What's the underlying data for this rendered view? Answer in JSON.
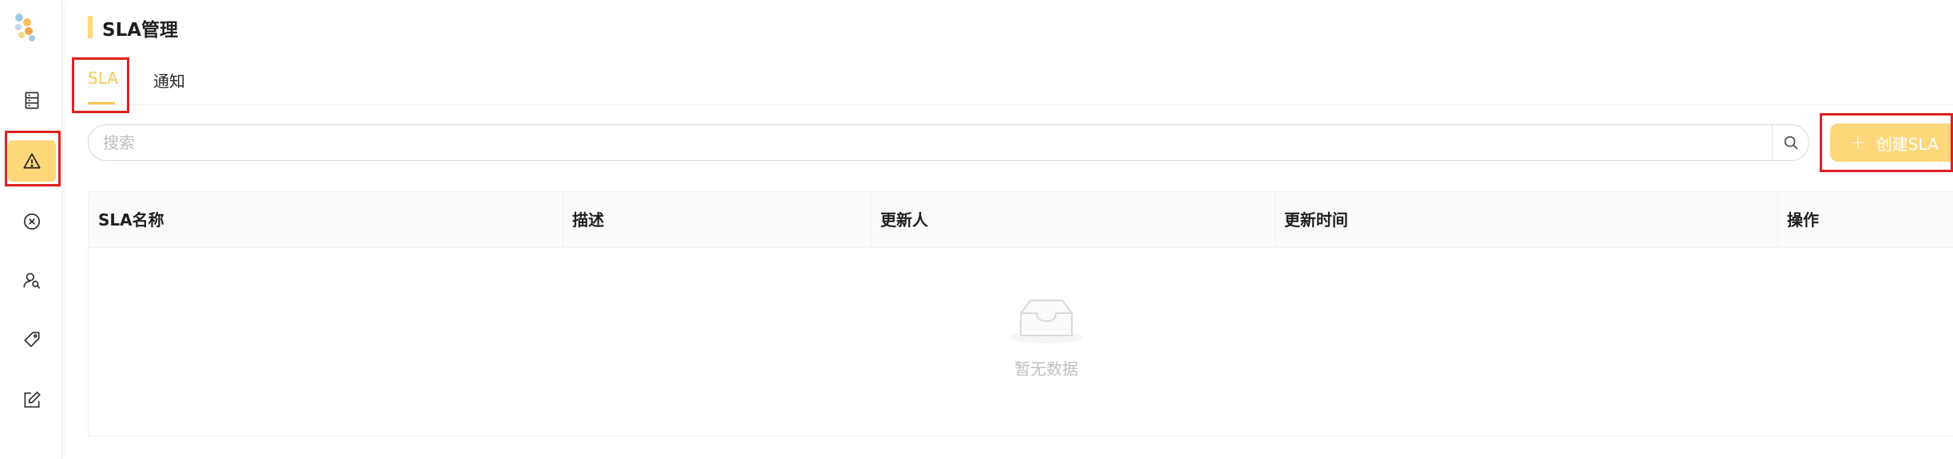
{
  "page": {
    "title": "SLA管理"
  },
  "sidebar": {
    "logo": "logo-icon",
    "items": [
      {
        "icon": "server-list-icon",
        "active": false
      },
      {
        "icon": "warning-triangle-icon",
        "active": true
      },
      {
        "icon": "close-circle-icon",
        "active": false
      },
      {
        "icon": "user-search-icon",
        "active": false
      },
      {
        "icon": "tag-icon",
        "active": false
      },
      {
        "icon": "edit-icon",
        "active": false
      }
    ]
  },
  "tabs": [
    {
      "label": "SLA",
      "active": true
    },
    {
      "label": "通知",
      "active": false
    }
  ],
  "search": {
    "placeholder": "搜索",
    "value": ""
  },
  "toolbar": {
    "create_label": "创建SLA",
    "create_icon": "+"
  },
  "table": {
    "columns": [
      "SLA名称",
      "描述",
      "更新人",
      "更新时间",
      "操作"
    ],
    "rows": [],
    "empty_text": "暂无数据"
  },
  "colors": {
    "accent": "#fdd77a",
    "accent_text": "#f5c957",
    "annotation": "#e02020"
  }
}
